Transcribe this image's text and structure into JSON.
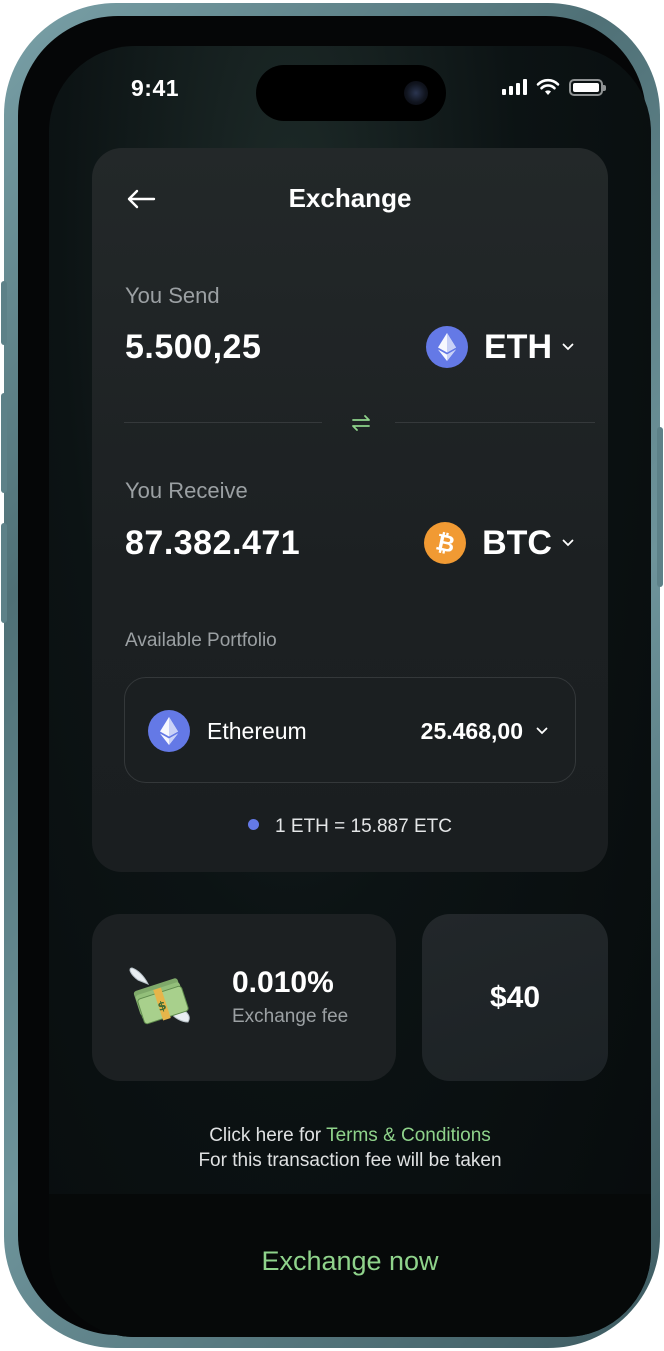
{
  "status_bar": {
    "time": "9:41"
  },
  "header": {
    "title": "Exchange"
  },
  "send": {
    "label": "You Send",
    "amount": "5.500,25",
    "coin": "ETH"
  },
  "receive": {
    "label": "You Receive",
    "amount": "87.382.471",
    "coin": "BTC"
  },
  "portfolio": {
    "label": "Available Portfolio",
    "asset_name": "Ethereum",
    "asset_value": "25.468,00",
    "rate": "1 ETH = 15.887 ETC"
  },
  "fee": {
    "percent": "0.010%",
    "label": "Exchange fee",
    "price": "$40"
  },
  "terms": {
    "prefix": "Click here for ",
    "link": "Terms & Conditions",
    "note": "For this transaction fee will be taken"
  },
  "action": {
    "label": "Exchange now"
  },
  "colors": {
    "accent_green": "#8fd38b",
    "eth_blue": "#6479e6",
    "btc_orange": "#f19a33",
    "card_bg": "#1c2022"
  },
  "icons": [
    "back-arrow-icon",
    "eth-icon",
    "btc-icon",
    "swap-icon",
    "chevron-down-icon",
    "money-wings-icon",
    "signal-icon",
    "wifi-icon",
    "battery-icon"
  ]
}
